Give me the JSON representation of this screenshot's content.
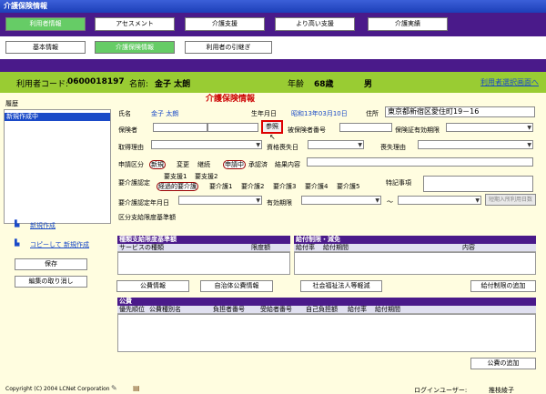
{
  "window": {
    "title": "介護保険情報"
  },
  "tabs": [
    {
      "label": "利用者情報",
      "selected": true
    },
    {
      "label": "アセスメント"
    },
    {
      "label": "介護支援"
    },
    {
      "label": "より高い支援"
    },
    {
      "label": "介護実績"
    }
  ],
  "subtabs": [
    {
      "label": "基本情報"
    },
    {
      "label": "介護保険情報",
      "selected": true
    },
    {
      "label": "利用者の引継ぎ"
    }
  ],
  "userbar": {
    "code_label": "利用者コード:",
    "code": "0600018197",
    "name_label": "名前:",
    "name": "金子 太朗",
    "age_label": "年齢",
    "age": "68歳",
    "gender": "男",
    "switch_link": "利用者選択画面へ"
  },
  "history": {
    "label": "履歴",
    "items": [
      "新規作成中"
    ]
  },
  "left_actions": {
    "new": "新規作成",
    "copy_new": "コピーして 新規作成",
    "save": "保存",
    "cancel": "編集の取り消し"
  },
  "form": {
    "section_title": "介護保険情報",
    "name_label": "氏名",
    "name_value": "金子 太朗",
    "birth_label": "生年月日",
    "birth_value": "昭和13年03月10日",
    "address_label": "住所",
    "address_value": "東京都新宿区愛住町19－16",
    "insurer_label": "保険者",
    "ref_button": "参照",
    "insured_no_label": "被保険者番号",
    "cert_valid_label": "保険証有効期限",
    "acquired_label": "取得理由",
    "lost_date_label": "資格喪失日",
    "lost_reason_label": "喪失理由",
    "app_label": "申請区分",
    "app_new": "新規",
    "app_change": "変更",
    "app_cont": "継続",
    "app_applying": "申請中",
    "app_approved": "承認済",
    "result_label": "結果内容",
    "care_label": "要介護認定",
    "care_support": [
      "要支援1",
      "要支援2"
    ],
    "care_levels": [
      "経過的要介護",
      "要介護1",
      "要介護2",
      "要介護3",
      "要介護4",
      "要介護5"
    ],
    "special_label": "特記事項",
    "care_date_label": "要介護認定年月日",
    "valid_label": "有効期限",
    "range_sep": "～",
    "short_btn": "短期入所利用日数",
    "limit_label": "区分支給限度基準額"
  },
  "tables": {
    "limit": {
      "title": "種類支給限度基準額",
      "cols": [
        "サービスの種類",
        "限度額"
      ]
    },
    "benefit": {
      "title": "給付制限・減免",
      "cols": [
        "給付率",
        "給付期間",
        "内容"
      ]
    },
    "public": {
      "title": "公費",
      "cols": [
        "優先順位",
        "公費種別名",
        "負担者番号",
        "受給者番号",
        "自己負担額",
        "給付率",
        "給付期間"
      ]
    }
  },
  "buttons": {
    "public": "公費情報",
    "local": "自治体公費情報",
    "social": "社会福祉法人等軽減",
    "add_benefit": "給付制限の追加",
    "add_public": "公費の追加"
  },
  "footer": {
    "copyright": "Copyright (C) 2004 LCNet Corporation",
    "login_label": "ログインユーザー:",
    "login_user": "推枝綾子"
  }
}
